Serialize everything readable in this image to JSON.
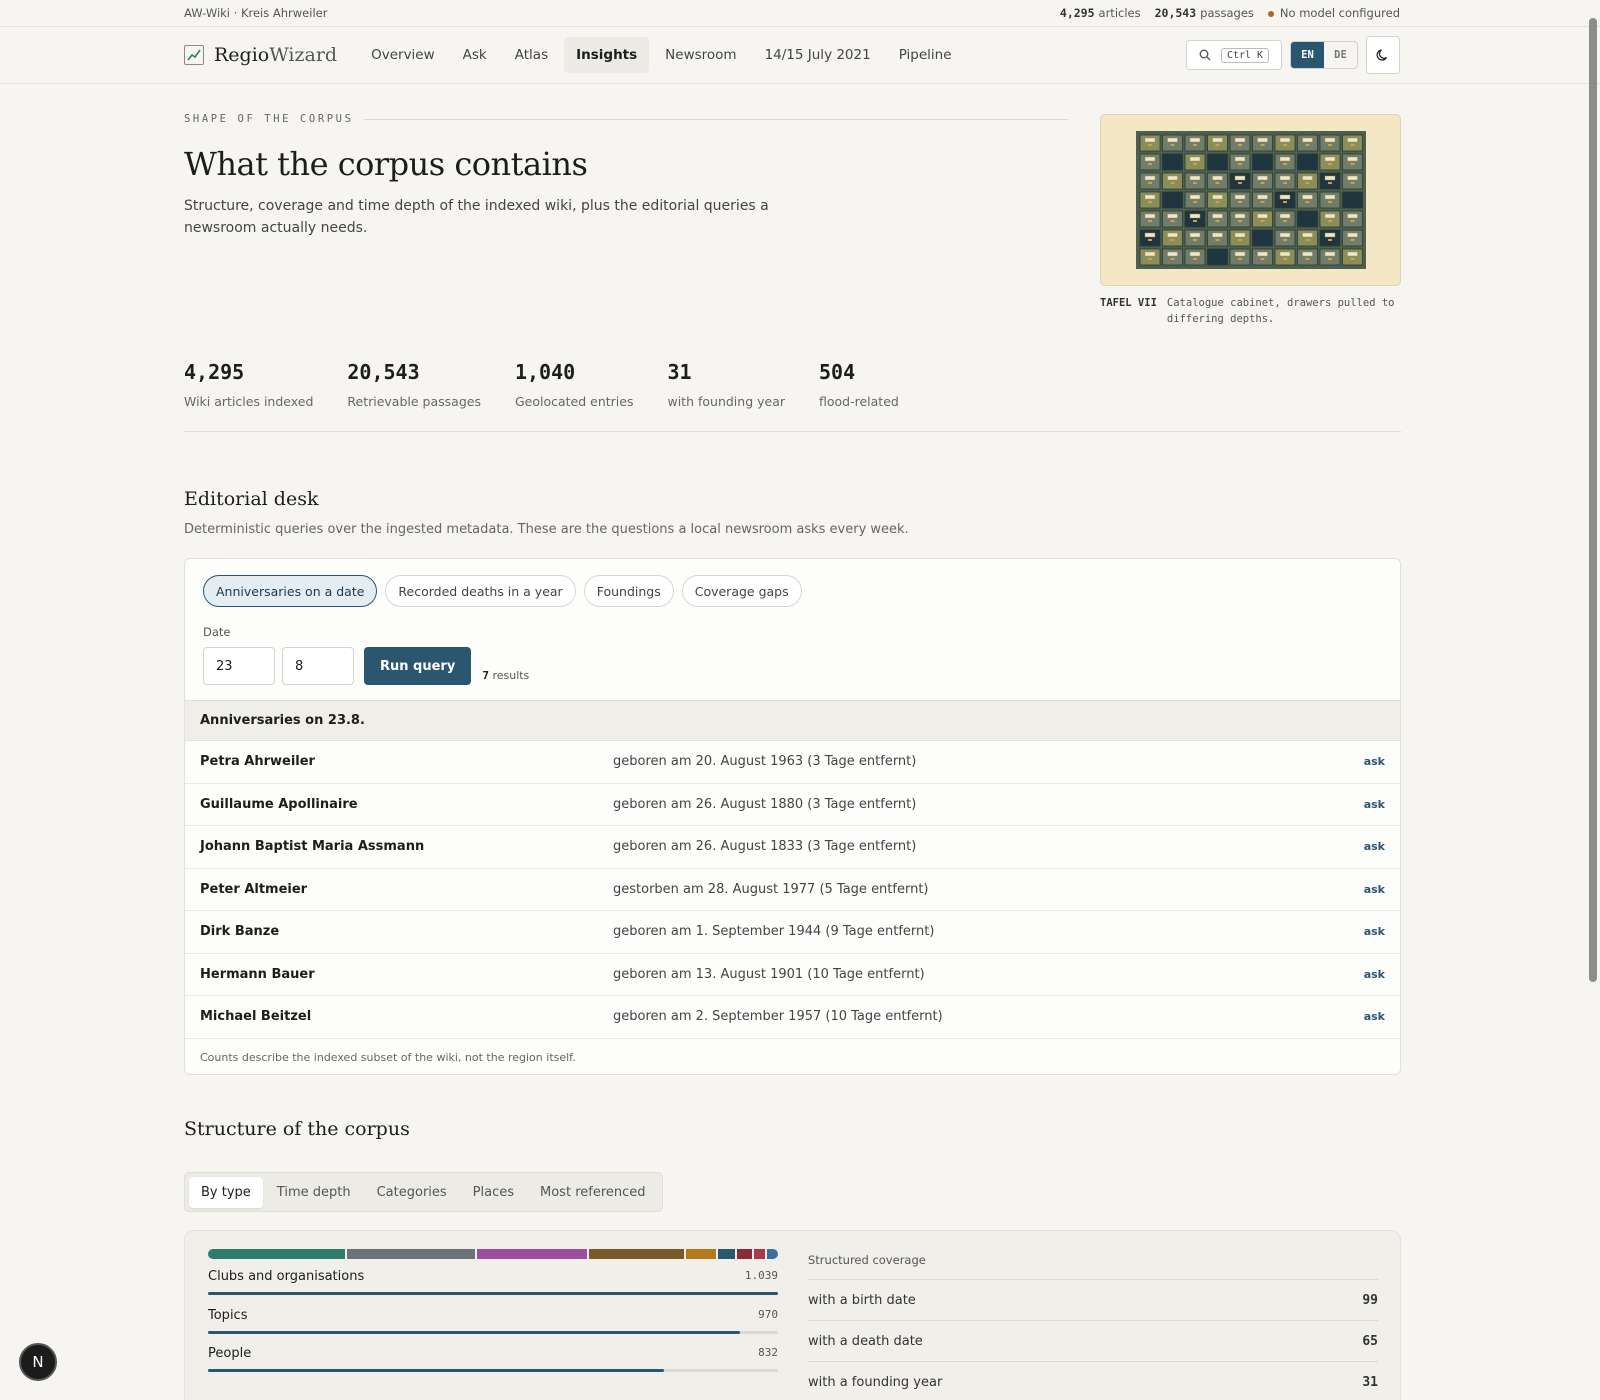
{
  "topbar": {
    "site": "AW-Wiki · Kreis Ahrweiler",
    "articles_num": "4,295",
    "articles_label": "articles",
    "passages_num": "20,543",
    "passages_label": "passages",
    "model_status": "No model configured",
    "status_color": "#b5651d"
  },
  "nav": {
    "brand_a": "Regio",
    "brand_b": "Wizard",
    "links": [
      "Overview",
      "Ask",
      "Atlas",
      "Insights",
      "Newsroom",
      "14/15 July 2021",
      "Pipeline"
    ],
    "active": "Insights",
    "search_kbd": "Ctrl K",
    "lang_en": "EN",
    "lang_de": "DE"
  },
  "hero": {
    "kicker": "SHAPE OF THE CORPUS",
    "title": "What the corpus contains",
    "lede": "Structure, coverage and time depth of the indexed wiki, plus the editorial queries a newsroom actually needs.",
    "plate_label": "TAFEL VII",
    "plate_caption": "Catalogue cabinet, drawers pulled to differing depths."
  },
  "stats": [
    {
      "value": "4,295",
      "label": "Wiki articles indexed"
    },
    {
      "value": "20,543",
      "label": "Retrievable passages"
    },
    {
      "value": "1,040",
      "label": "Geolocated entries"
    },
    {
      "value": "31",
      "label": "with founding year"
    },
    {
      "value": "504",
      "label": "flood-related"
    }
  ],
  "editorial": {
    "title": "Editorial desk",
    "subtitle": "Deterministic queries over the ingested metadata. These are the questions a local newsroom asks every week.",
    "pills": [
      "Anniversaries on a date",
      "Recorded deaths in a year",
      "Foundings",
      "Coverage gaps"
    ],
    "date_label": "Date",
    "day": "23",
    "month": "8",
    "run_label": "Run query",
    "result_num": "7",
    "result_label": "results",
    "results_title": "Anniversaries on 23.8.",
    "ask_label": "ask",
    "rows": [
      {
        "name": "Petra Ahrweiler",
        "detail": "geboren am 20. August 1963 (3 Tage entfernt)"
      },
      {
        "name": "Guillaume Apollinaire",
        "detail": "geboren am 26. August 1880 (3 Tage entfernt)"
      },
      {
        "name": "Johann Baptist Maria Assmann",
        "detail": "geboren am 26. August 1833 (3 Tage entfernt)"
      },
      {
        "name": "Peter Altmeier",
        "detail": "gestorben am 28. August 1977 (5 Tage entfernt)"
      },
      {
        "name": "Dirk Banze",
        "detail": "geboren am 1. September 1944 (9 Tage entfernt)"
      },
      {
        "name": "Hermann Bauer",
        "detail": "geboren am 13. August 1901 (10 Tage entfernt)"
      },
      {
        "name": "Michael Beitzel",
        "detail": "geboren am 2. September 1957 (10 Tage entfernt)"
      }
    ],
    "footnote": "Counts describe the indexed subset of the wiki, not the region itself."
  },
  "structure": {
    "title": "Structure of the corpus",
    "tabs": [
      "By type",
      "Time depth",
      "Categories",
      "Places",
      "Most referenced"
    ],
    "active_tab": "By type",
    "stack_colors": [
      "#2e7d6b",
      "#6b7378",
      "#9b4f9e",
      "#7a5a2a",
      "#b5781d",
      "#2a5670",
      "#8c2a3a",
      "#a83a4c",
      "#3a6f9e"
    ],
    "stack_values": [
      1039,
      970,
      832,
      720,
      230,
      130,
      110,
      90,
      80
    ],
    "types": [
      {
        "label": "Clubs and organisations",
        "count": "1.039",
        "value": 1039
      },
      {
        "label": "Topics",
        "count": "970",
        "value": 970
      },
      {
        "label": "People",
        "count": "832",
        "value": 832
      }
    ],
    "max_type": 1039,
    "coverage_title": "Structured coverage",
    "coverage": [
      {
        "label": "with a birth date",
        "value": "99"
      },
      {
        "label": "with a death date",
        "value": "65"
      },
      {
        "label": "with a founding year",
        "value": "31"
      }
    ]
  },
  "fab_letter": "N"
}
